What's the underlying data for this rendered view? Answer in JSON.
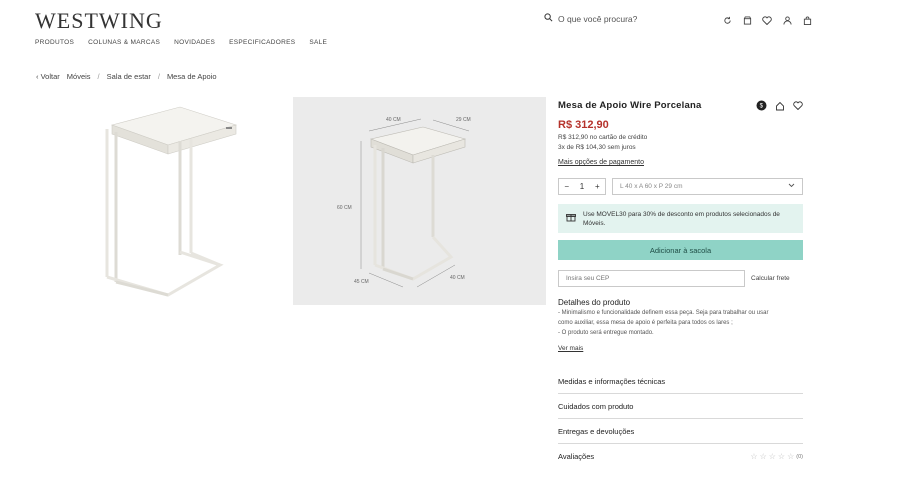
{
  "header": {
    "logo": "WESTWING",
    "nav": [
      "PRODUTOS",
      "COLUNAS & MARCAS",
      "NOVIDADES",
      "ESPECIFICADORES",
      "SALE"
    ],
    "search_placeholder": "O que você procura?"
  },
  "breadcrumb": {
    "back": "Voltar",
    "items": [
      "Móveis",
      "Sala de estar",
      "Mesa de Apoio"
    ]
  },
  "product": {
    "title": "Mesa de Apoio Wire Porcelana",
    "price": "R$ 312,90",
    "card_price": "R$ 312,90 no cartão de crédito",
    "installments": "3x de R$ 104,30 sem juros",
    "payment_link": "Mais opções de pagamento",
    "quantity": "1",
    "qty_minus": "−",
    "qty_plus": "+",
    "size": "L 40 x A 60 x P 29 cm",
    "promo": "Use MOVEL30 para 30% de desconto em produtos selecionados de Móveis.",
    "add_to_cart": "Adicionar à sacola",
    "cep_placeholder": "Insira seu CEP",
    "cep_button": "Calcular frete",
    "description_title": "Detalhes do produto",
    "description_lines": [
      "- Minimalismo e funcionalidade definem essa peça. Seja para trabalhar ou usar",
      "como auxiliar, essa mesa de apoio é perfeita para todos os lares ;",
      "- O produto será entregue montado."
    ],
    "see_more": "Ver mais",
    "accordion": [
      "Medidas e informações técnicas",
      "Cuidados com produto",
      "Entregas e devoluções",
      "Avaliações"
    ],
    "rating_count": "(0)"
  },
  "dimensions": {
    "top_width": "40 CM",
    "top_depth": "29 CM",
    "height": "60 CM",
    "base_depth": "45 CM",
    "base_width": "40 CM"
  },
  "colors": {
    "price": "#b5322b",
    "button": "#8fd3c6",
    "promo_bg": "#e3f3ef"
  }
}
